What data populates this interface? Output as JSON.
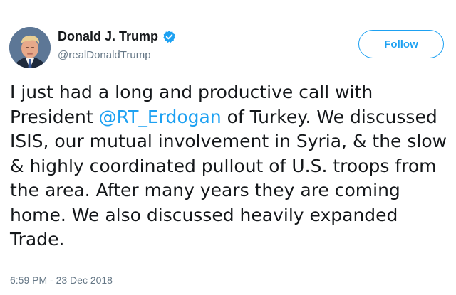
{
  "user": {
    "display_name": "Donald J. Trump",
    "handle": "@realDonaldTrump",
    "verified_icon": "verified-badge-icon",
    "avatar": "profile-photo"
  },
  "follow_button": {
    "label": "Follow"
  },
  "tweet": {
    "segments": [
      {
        "type": "text",
        "text": "I just had a long and productive call with President "
      },
      {
        "type": "mention",
        "text": "@RT_Erdogan"
      },
      {
        "type": "text",
        "text": " of Turkey. We discussed ISIS, our mutual involvement in Syria, & the slow & highly coordinated pullout of U.S. troops from the area. After many years they are coming home. We also discussed heavily expanded Trade."
      }
    ],
    "timestamp": "6:59 PM - 23 Dec 2018"
  },
  "colors": {
    "accent": "#1da1f2",
    "text": "#14171a",
    "secondary_text": "#657786"
  }
}
